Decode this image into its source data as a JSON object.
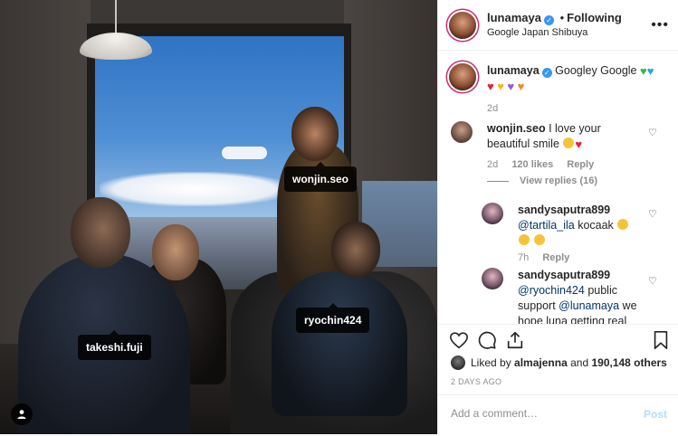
{
  "header": {
    "username": "lunamaya",
    "separator": "•",
    "follow_state": "Following",
    "location": "Google Japan Shibuya",
    "more_glyph": "•••"
  },
  "caption": {
    "username": "lunamaya",
    "text": "Googley Google",
    "emojis": [
      "green-heart",
      "blue-heart",
      "red-heart",
      "yellow-heart",
      "purple-heart",
      "orange-heart"
    ],
    "age": "2d"
  },
  "comments": [
    {
      "username": "wonjin.seo",
      "text": "I love your beautiful smile",
      "age": "2d",
      "likes": "120 likes",
      "reply_label": "Reply",
      "view_replies": "View replies (16)"
    }
  ],
  "replies": [
    {
      "username": "sandysaputra899",
      "mention": "@tartila_ila",
      "text": " kocaak",
      "age": "7h",
      "reply_label": "Reply"
    },
    {
      "username": "sandysaputra899",
      "mention": "@ryochin424",
      "text_part1": " public support ",
      "mention2": "@lunamaya",
      "text_part2": " we hope luna getting real"
    }
  ],
  "likes": {
    "prefix": "Liked by ",
    "user": "almajenna",
    "suffix": " and ",
    "count": "190,148 others"
  },
  "date": "2 DAYS AGO",
  "add_comment": {
    "placeholder": "Add a comment…",
    "post_label": "Post"
  },
  "photo_tags": {
    "wonjin": "wonjin.seo",
    "ryo": "ryochin424",
    "takeshi": "takeshi.fuji"
  },
  "colors": {
    "story_ring": "#c92f72",
    "verified": "#3897f0",
    "post_disabled": "#b2dffc",
    "meta_gray": "#8e8e8e"
  }
}
